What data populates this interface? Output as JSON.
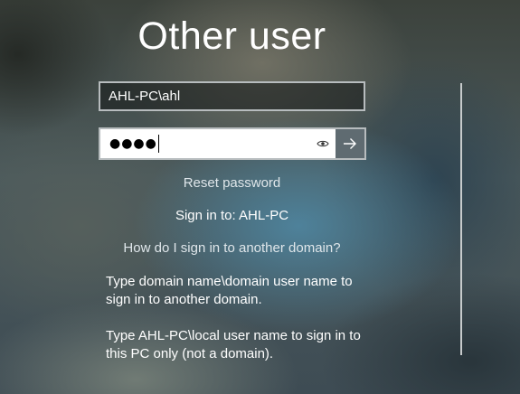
{
  "login": {
    "title": "Other user",
    "username_value": "AHL-PC\\ahl",
    "password_mask": "●●●●",
    "reveal_icon": "eye-icon",
    "submit_icon": "arrow-right-icon",
    "reset_password": "Reset password",
    "sign_in_to": "Sign in to: AHL-PC",
    "domain_help_link": "How do I sign in to another domain?",
    "help_line_1": "Type domain name\\domain user name to sign in to another domain.",
    "help_line_2": "Type AHL-PC\\local user name to sign in to this PC only (not a domain)."
  },
  "colors": {
    "submit_button_bg": "#5f6b71",
    "field_border": "#b7bcbe"
  }
}
